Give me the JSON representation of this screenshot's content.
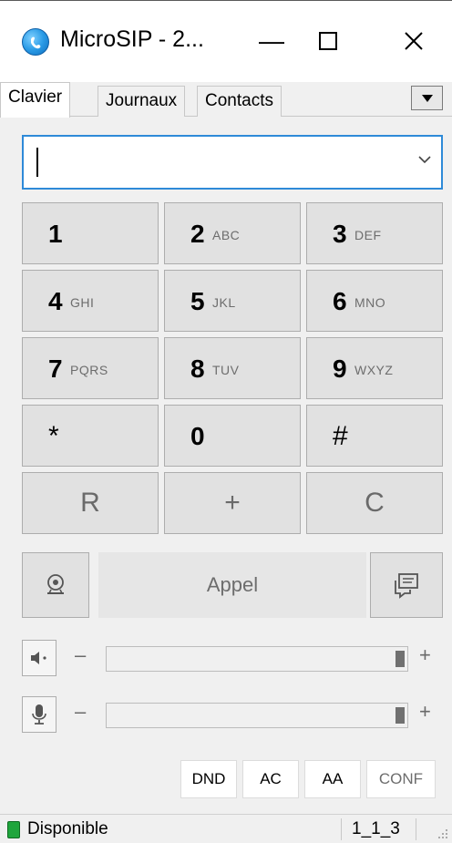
{
  "window": {
    "title": "MicroSIP - 2...",
    "minimize": "—",
    "maximize": "☐",
    "close": "✕"
  },
  "tabs": [
    {
      "label": "Clavier",
      "active": true
    },
    {
      "label": "Journaux",
      "active": false
    },
    {
      "label": "Contacts",
      "active": false
    }
  ],
  "tab_menu_icon": "dropdown-arrow-icon",
  "dial": {
    "value": "",
    "icon": "chevron-down-icon"
  },
  "keypad": {
    "keys": [
      {
        "digit": "1",
        "letters": ""
      },
      {
        "digit": "2",
        "letters": "ABC"
      },
      {
        "digit": "3",
        "letters": "DEF"
      },
      {
        "digit": "4",
        "letters": "GHI"
      },
      {
        "digit": "5",
        "letters": "JKL"
      },
      {
        "digit": "6",
        "letters": "MNO"
      },
      {
        "digit": "7",
        "letters": "PQRS"
      },
      {
        "digit": "8",
        "letters": "TUV"
      },
      {
        "digit": "9",
        "letters": "WXYZ"
      },
      {
        "digit": "*",
        "letters": ""
      },
      {
        "digit": "0",
        "letters": ""
      },
      {
        "digit": "#",
        "letters": ""
      }
    ],
    "function_keys": [
      "R",
      "+",
      "C"
    ]
  },
  "call": {
    "label": "Appel",
    "video_icon": "webcam-icon",
    "message_icon": "chat-icon"
  },
  "volume": {
    "speaker": {
      "minus": "–",
      "plus": "+",
      "level": 1.0,
      "icon": "speaker-icon"
    },
    "microphone": {
      "minus": "–",
      "plus": "+",
      "level": 1.0,
      "icon": "microphone-icon"
    }
  },
  "options": [
    "DND",
    "AC",
    "AA",
    "CONF"
  ],
  "status": {
    "text": "Disponible",
    "account": "1_1_3",
    "color": "#1fa53c"
  }
}
